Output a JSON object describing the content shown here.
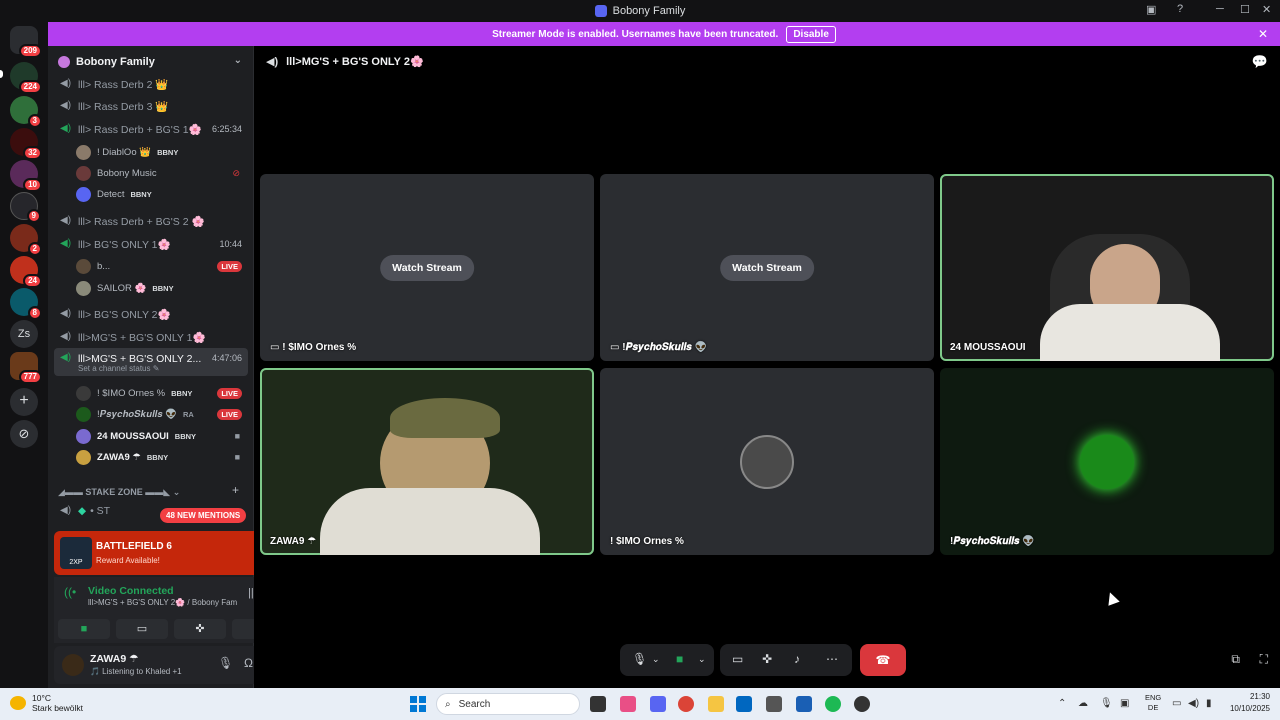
{
  "window": {
    "title": "Bobony Family"
  },
  "banner": {
    "text": "Streamer Mode is enabled. Usernames have been truncated.",
    "button": "Disable"
  },
  "servers": [
    {
      "badge": "209"
    },
    {
      "badge": "224"
    },
    {
      "badge": "3"
    },
    {
      "badge": "32"
    },
    {
      "badge": "10"
    },
    {
      "badge": "9"
    },
    {
      "badge": "2"
    },
    {
      "badge": "24"
    },
    {
      "badge": "8"
    },
    {
      "label": "Zs"
    },
    {
      "badge": "777"
    }
  ],
  "guild": {
    "name": "Bobony Family"
  },
  "channels": {
    "rass2": "lll> Rass Derb 2 👑",
    "rass3": "lll> Rass Derb 3 👑",
    "rassbg1": "lll> Rass Derb + BG'S 1🌸",
    "rassbg1_time": "6:25:34",
    "rassbg2": "lll> Rass Derb + BG'S 2 🌸",
    "bg1": "lll> BG'S ONLY 1🌸",
    "bg1_time": "10:44",
    "bg2": "lll> BG'S ONLY 2🌸",
    "mgbg1": "lll>MG'S + BG'S ONLY 1🌸",
    "mgbg2": "lll>MG'S + BG'S ONLY 2...",
    "mgbg2_time": "4:47:06",
    "mgbg2_status": "Set a channel status ✎",
    "stake_zone": "◢▬▬ STAKE ZONE ▬▬◣",
    "st_partial": "• ST"
  },
  "users": {
    "diablo": {
      "name": "! DiablOo 👑",
      "tag": "BBNY"
    },
    "music": {
      "name": "Bobony Music"
    },
    "detect": {
      "name": "Detect",
      "tag": "BBNY"
    },
    "b": {
      "name": "b...",
      "live": "LIVE"
    },
    "sailor": {
      "name": "SAILOR 🌸",
      "tag": "BBNY"
    },
    "simo": {
      "name": "! $IMO Ornes %",
      "tag": "BBNY",
      "live": "LIVE"
    },
    "psycho": {
      "name": "!𝑷𝒔𝒚𝒄𝒉𝒐𝑺𝒌𝒖𝒍𝒍𝒔 👽",
      "tag": "RA",
      "live": "LIVE"
    },
    "mouss": {
      "name": "24 MOUSSAOUI",
      "tag": "BBNY"
    },
    "zawa": {
      "name": "ZAWA9 ☂",
      "tag": "BBNY"
    }
  },
  "mentions": "48 NEW MENTIONS",
  "promo": {
    "title": "BATTLEFIELD 6",
    "subtitle": "Reward Available!",
    "logo_text": "2XP"
  },
  "voice": {
    "status": "Video Connected",
    "channel": "lll>MG'S + BG'S ONLY 2🌸 / Bobony Fam..."
  },
  "me": {
    "name": "ZAWA9 ☂",
    "activity": "🎵 Listening to Khaled +1"
  },
  "call": {
    "title": "lll>MG'S + BG'S ONLY 2🌸",
    "tiles": [
      {
        "name": "! $IMO Ornes %",
        "action": "Watch Stream"
      },
      {
        "name": "!𝑷𝒔𝒚𝒄𝒉𝒐𝑺𝒌𝒖𝒍𝒍𝒔 👽",
        "action": "Watch Stream"
      },
      {
        "name": "24 MOUSSAOUI"
      },
      {
        "name": "ZAWA9 ☂"
      },
      {
        "name": "! $IMO Ornes %"
      },
      {
        "name": "!𝑷𝒔𝒚𝒄𝒉𝒐𝑺𝒌𝒖𝒍𝒍𝒔 👽"
      }
    ]
  },
  "taskbar": {
    "weather_temp": "10°C",
    "weather_desc": "Stark bewölkt",
    "search_placeholder": "Search",
    "lang1": "ENG",
    "lang2": "DE",
    "time": "21:30",
    "date": "10/10/2025"
  },
  "colors": {
    "accent": "#5865f2",
    "banner": "#b33ef0",
    "live": "#da373c",
    "connected": "#23a55a",
    "promo": "#c5270b"
  }
}
